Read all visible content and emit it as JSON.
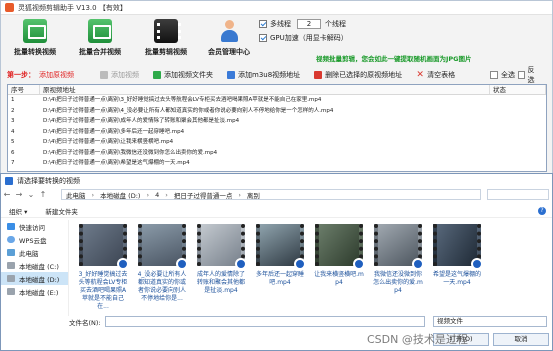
{
  "app": {
    "title": "灵狐视频剪辑助手 V13.0  【有效】",
    "toolbar": [
      {
        "label": "批量转换视频",
        "icon": "video-convert-icon"
      },
      {
        "label": "批量合并视频",
        "icon": "video-merge-icon"
      },
      {
        "label": "批量剪辑视频",
        "icon": "film-clip-icon"
      },
      {
        "label": "会员管理中心",
        "icon": "member-user-icon"
      }
    ],
    "options": {
      "multithread_label": "多线程",
      "thread_count": "2",
      "thread_unit": "个线程",
      "gpu_label": "GPU加速（用显卡解码）"
    },
    "tip": "视频批量剪辑，您会如此一键提取随机画面为JPG图片",
    "actionbar": {
      "step_label": "第一步：",
      "add_link": "添加原视频",
      "add_video": "添加视频",
      "add_folder": "添加视频文件夹",
      "add_m3u8": "添加m3u8视频地址",
      "delete_selected": "删除已选择的原视频地址",
      "clear_table": "清空表格",
      "select_all": "全选",
      "invert": "反选"
    },
    "table": {
      "headers": [
        "序号",
        "原视频地址",
        "状态"
      ],
      "rows": [
        {
          "no": "1",
          "path": "D:\\4\\把日子过得普通一点\\离别\\3_好好睡觉搞过去头等航程会LV专柜买去酒吧喝果照A苹就是不能自己在家里.mp4",
          "status": ""
        },
        {
          "no": "2",
          "path": "D:\\4\\把日子过得普通一点\\离别\\4_没必要让所有人都知道真实的你或者你说必要向别人不停地给你是一个怎样的人.mp4",
          "status": ""
        },
        {
          "no": "3",
          "path": "D:\\4\\把日子过得普通一点\\离别\\成年人的爱情除了转账和聚会其他都是扯淡.mp4",
          "status": ""
        },
        {
          "no": "4",
          "path": "D:\\4\\把日子过得普通一点\\离别\\多年后还一起穿睡吧.mp4",
          "status": ""
        },
        {
          "no": "5",
          "path": "D:\\4\\把日子过得普通一点\\离别\\让我来横竖横吧.mp4",
          "status": ""
        },
        {
          "no": "6",
          "path": "D:\\4\\把日子过得普通一点\\离别\\我微信还没微到你怎么出卖你的爱.mp4",
          "status": ""
        },
        {
          "no": "7",
          "path": "D:\\4\\把日子过得普通一点\\离别\\希望是这气爆棚的一天.mp4",
          "status": ""
        }
      ]
    }
  },
  "dialog": {
    "title": "请选择要转换的视频",
    "breadcrumb": [
      "此电脑",
      "本地磁盘 (D:)",
      "4",
      "把日子过得普通一点",
      "离别"
    ],
    "toolbar": [
      "组织 ▾",
      "新建文件夹"
    ],
    "sidebar": [
      {
        "label": "快速访问",
        "icon": "quick-access-icon",
        "selected": false
      },
      {
        "label": "WPS云盘",
        "icon": "cloud-icon",
        "selected": false
      },
      {
        "label": "此电脑",
        "icon": "computer-icon",
        "selected": false
      },
      {
        "label": "本地磁盘 (C:)",
        "icon": "drive-icon",
        "selected": false
      },
      {
        "label": "本地磁盘 (D:)",
        "icon": "drive-icon",
        "selected": true
      },
      {
        "label": "本地磁盘 (E:)",
        "icon": "drive-icon",
        "selected": false
      }
    ],
    "files": [
      {
        "name": "3_好好睡觉搞过去头等航程会LV专柜买去酒吧喝果照A苹就是不能自己在..."
      },
      {
        "name": "4_没必要让所有人都知道真实的你或者你说必要向别人不停地给你是..."
      },
      {
        "name": "成年人的爱情除了转账和聚会其他都是扯淡.mp4"
      },
      {
        "name": "多年后还一起穿睡吧.mp4"
      },
      {
        "name": "让我来横竖横吧.mp4"
      },
      {
        "name": "我微信还没微到你怎么出卖你的爱.mp4"
      },
      {
        "name": "希望是这气爆棚的一天.mp4"
      }
    ],
    "filename_label": "文件名(N):",
    "filetype": "视频文件",
    "open_label": "打开(O)",
    "cancel_label": "取消"
  },
  "watermark": "CSDN @技术是过程"
}
